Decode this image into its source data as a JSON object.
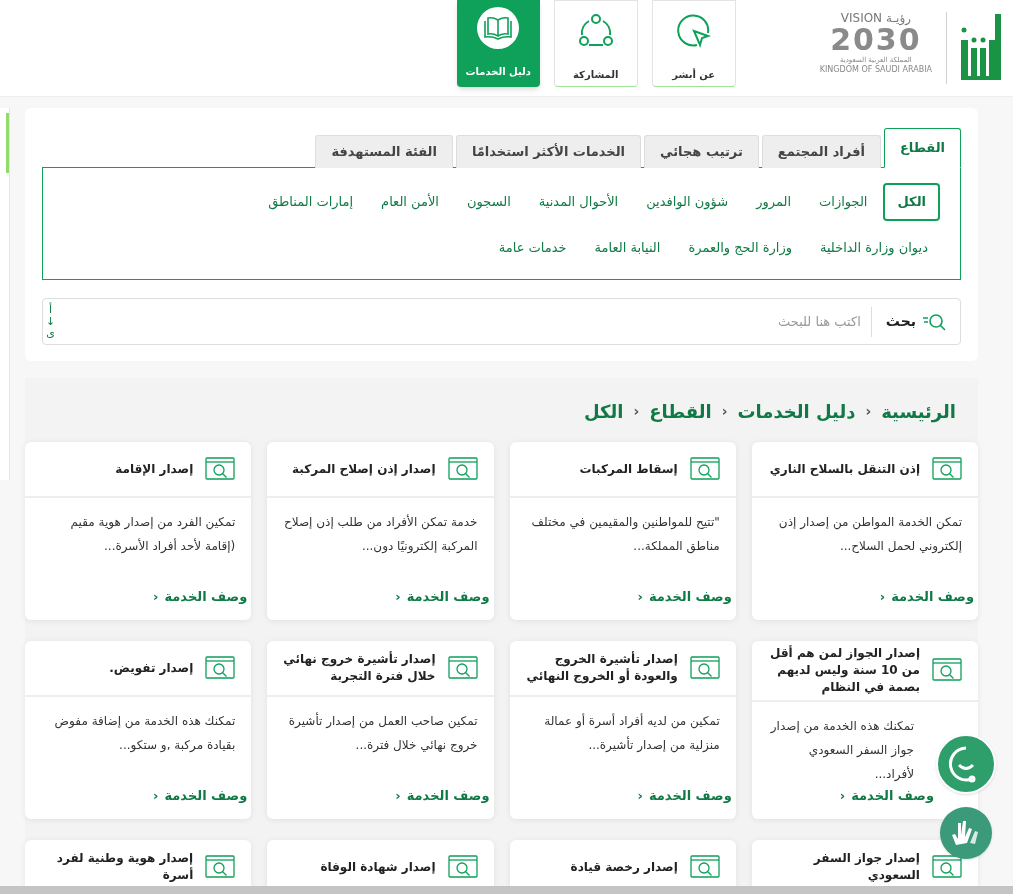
{
  "header": {
    "vision_logo": {
      "word": "VISION",
      "arabic": "رؤيـة",
      "year": "2030",
      "kingdom_ar": "المملكة العربية السعودية",
      "kingdom_en": "KINGDOM OF SAUDI ARABIA"
    },
    "nav": [
      {
        "label": "عن أبشر",
        "kind": "cursor",
        "selected": false
      },
      {
        "label": "المشاركة",
        "kind": "share",
        "selected": false
      },
      {
        "label": "دليل الخدمات",
        "kind": "book",
        "selected": true
      }
    ]
  },
  "tabs": [
    {
      "label": "القطاع",
      "selected": true
    },
    {
      "label": "أفراد المجتمع",
      "selected": false
    },
    {
      "label": "ترتيب هجائي",
      "selected": false
    },
    {
      "label": "الخدمات الأكثر استخدامًا",
      "selected": false
    },
    {
      "label": "الفئة المستهدفة",
      "selected": false
    }
  ],
  "sectors": [
    {
      "label": "الكل",
      "selected": true
    },
    {
      "label": "الجوازات",
      "selected": false
    },
    {
      "label": "المرور",
      "selected": false
    },
    {
      "label": "شؤون الوافدين",
      "selected": false
    },
    {
      "label": "الأحوال المدنية",
      "selected": false
    },
    {
      "label": "السجون",
      "selected": false
    },
    {
      "label": "الأمن العام",
      "selected": false
    },
    {
      "label": "إمارات المناطق",
      "selected": false
    },
    {
      "label": "ديوان وزارة الداخلية",
      "selected": false
    },
    {
      "label": "وزارة الحج والعمرة",
      "selected": false
    },
    {
      "label": "النيابة العامة",
      "selected": false
    },
    {
      "label": "خدمات عامة",
      "selected": false
    }
  ],
  "search": {
    "button": "بحث",
    "placeholder": "اكتب هنا للبحث",
    "sort": [
      "أ",
      "↓",
      "ى"
    ]
  },
  "breadcrumb": [
    {
      "kind": "link",
      "text": "الرئيسية"
    },
    {
      "kind": "separator",
      "text": "›"
    },
    {
      "kind": "link",
      "text": "دليل الخدمات"
    },
    {
      "kind": "separator",
      "text": "›"
    },
    {
      "kind": "link",
      "text": "القطاع"
    },
    {
      "kind": "separator",
      "text": "›"
    },
    {
      "kind": "link",
      "text": "الكل"
    }
  ],
  "services": [
    {
      "title": "إذن التنقل بالسلاح الناري",
      "description": "تمكن الخدمة المواطن من إصدار إذن إلكتروني لحمل السلاح...",
      "link": "وصف الخدمة",
      "link_chevron": "›"
    },
    {
      "title": "إسقاط المركبات",
      "description": "\"تتيح للمواطنين والمقيمين في مختلف مناطق المملكة...",
      "link": "وصف الخدمة",
      "link_chevron": "›"
    },
    {
      "title": "إصدار إذن إصلاح المركبة",
      "description": "خدمة تمكن الأفراد من طلب إذن إصلاح المركبة إلكترونيًا دون...",
      "link": "وصف الخدمة",
      "link_chevron": "›"
    },
    {
      "title": "إصدار الإقامة",
      "description": "تمكين الفرد من إصدار هوية مقيم (إقامة لأحد أفراد الأسرة...",
      "link": "وصف الخدمة",
      "link_chevron": "›"
    },
    {
      "title": "إصدار الجواز لمن هم أقل من 10 سنة وليس لديهم بصمة في النظام",
      "description": "تمكنك هذه الخدمة من إصدار جواز السفر السعودي لأفراد...",
      "link": "وصف الخدمة",
      "link_chevron": "›"
    },
    {
      "title": "إصدار تأشيرة الخروج والعودة أو الخروج النهائي",
      "description": "تمكين من لديه أفراد أسرة أو عمالة منزلية من إصدار تأشيرة...",
      "link": "وصف الخدمة",
      "link_chevron": "›"
    },
    {
      "title": "إصدار تأشيرة خروج نهائي خلال فترة التجربة",
      "description": "تمكين صاحب العمل من إصدار تأشيرة خروج نهائي خلال فترة...",
      "link": "وصف الخدمة",
      "link_chevron": "›"
    },
    {
      "title": "إصدار تفويض.",
      "description": "تمكنك هذه الخدمة من إضافة مفوض بقيادة مركبة ,و ستكو...",
      "link": "وصف الخدمة",
      "link_chevron": "›"
    },
    {
      "title": "إصدار جواز السفر السعودي"
    },
    {
      "title": "إصدار رخصة قيادة"
    },
    {
      "title": "إصدار شهادة الوفاة"
    },
    {
      "title": "إصدار هوية وطنية لفرد أسرة"
    }
  ]
}
